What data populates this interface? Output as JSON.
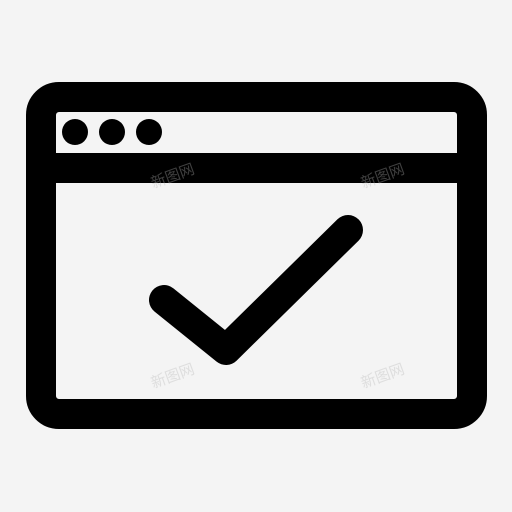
{
  "icon": {
    "name": "browser-window-check-icon",
    "stroke_color": "#000000",
    "fill_color": "#f4f4f4",
    "background_color": "#f4f4f4"
  },
  "watermarks": [
    {
      "text": "新图网"
    },
    {
      "text": "新图网"
    },
    {
      "text": "新图网"
    },
    {
      "text": "新图网"
    }
  ]
}
